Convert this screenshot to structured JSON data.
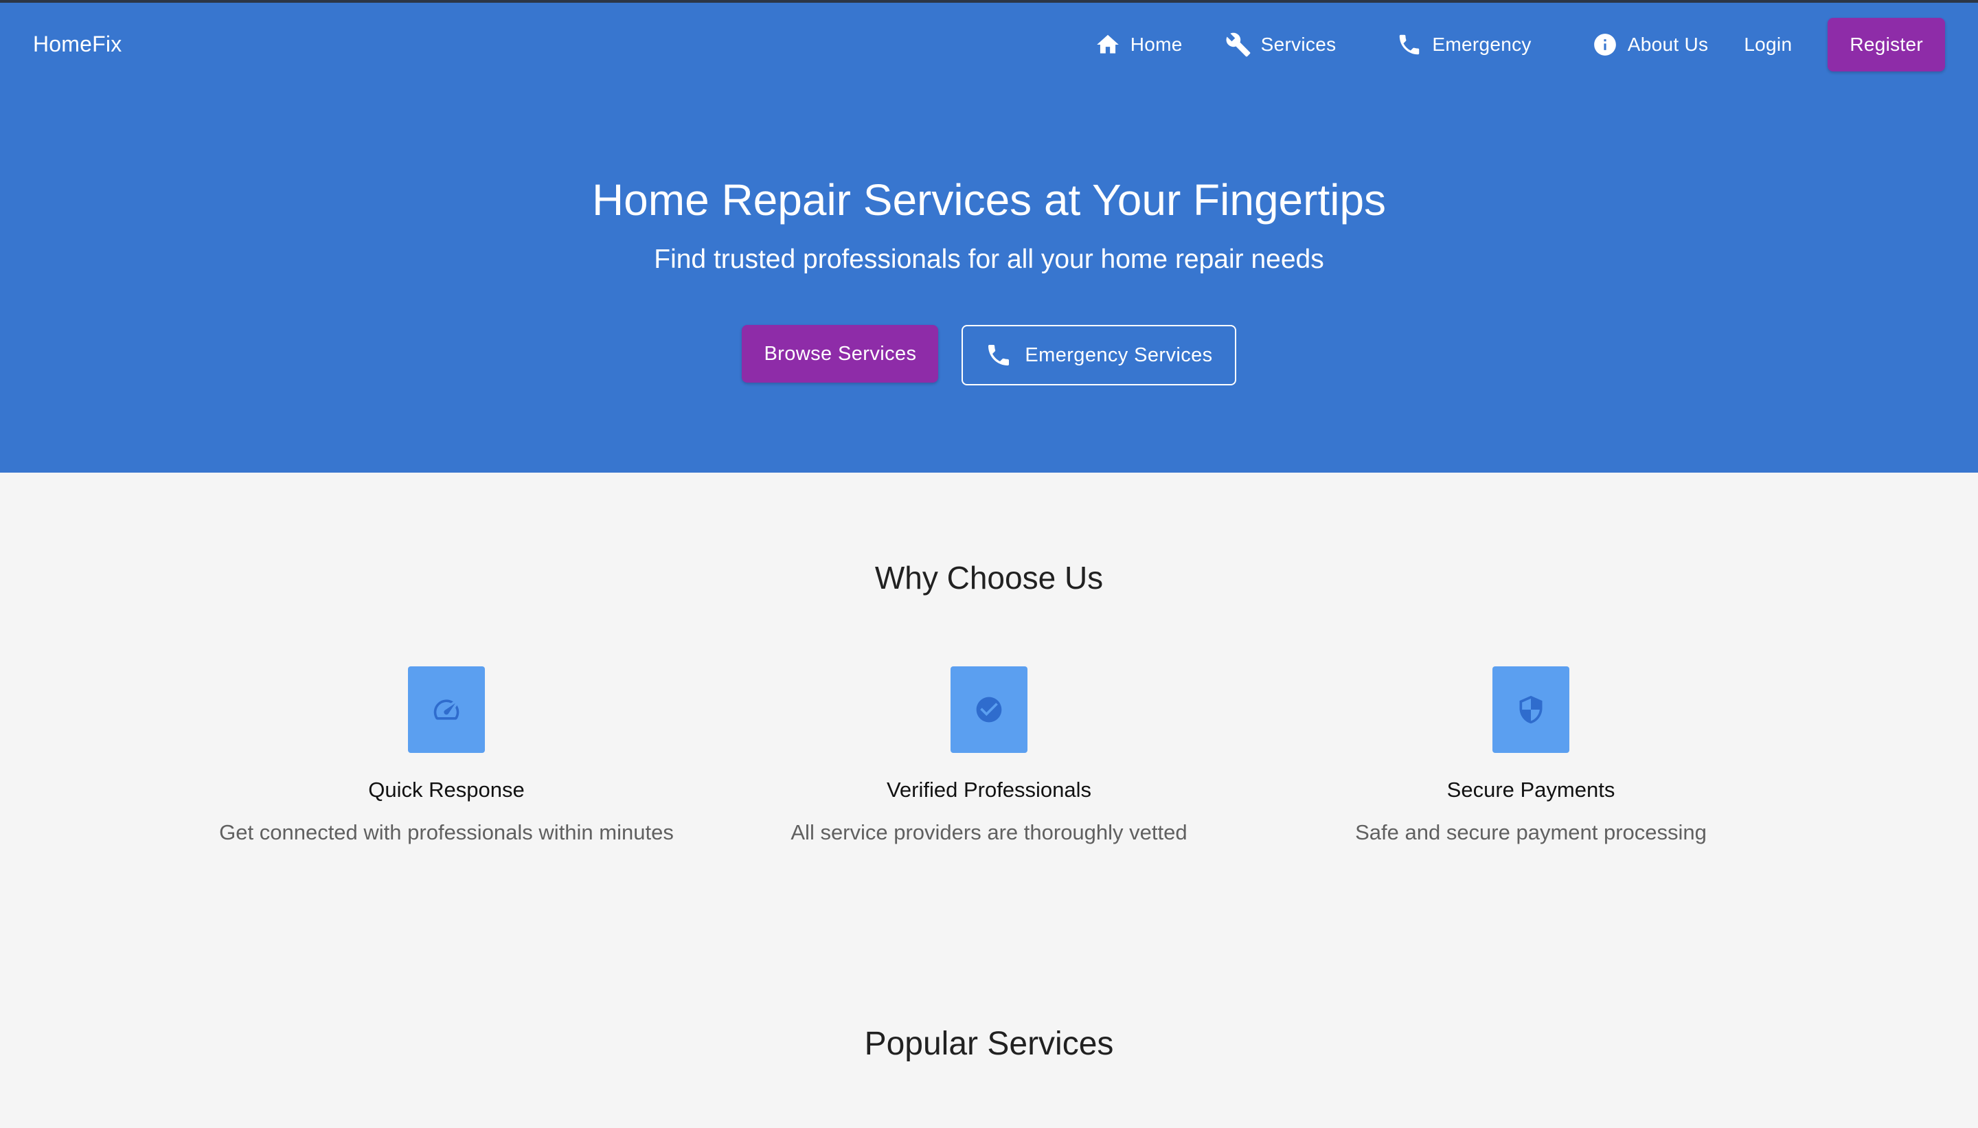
{
  "brand": "HomeFix",
  "nav": {
    "home": "Home",
    "services": "Services",
    "emergency": "Emergency",
    "about": "About Us",
    "login": "Login",
    "register": "Register"
  },
  "hero": {
    "title": "Home Repair Services at Your Fingertips",
    "subtitle": "Find trusted professionals for all your home repair needs",
    "browse_label": "Browse Services",
    "emergency_label": "Emergency Services"
  },
  "why": {
    "title": "Why Choose Us",
    "features": [
      {
        "icon": "speed-icon",
        "title": "Quick Response",
        "desc": "Get connected with professionals within minutes"
      },
      {
        "icon": "verified-icon",
        "title": "Verified Professionals",
        "desc": "All service providers are thoroughly vetted"
      },
      {
        "icon": "shield-icon",
        "title": "Secure Payments",
        "desc": "Safe and secure payment processing"
      }
    ]
  },
  "popular": {
    "title": "Popular Services"
  },
  "colors": {
    "primary": "#3876cf",
    "accent": "#8e2ca8",
    "feature_icon_bg": "#5b9ff0",
    "background": "#f5f5f5"
  }
}
